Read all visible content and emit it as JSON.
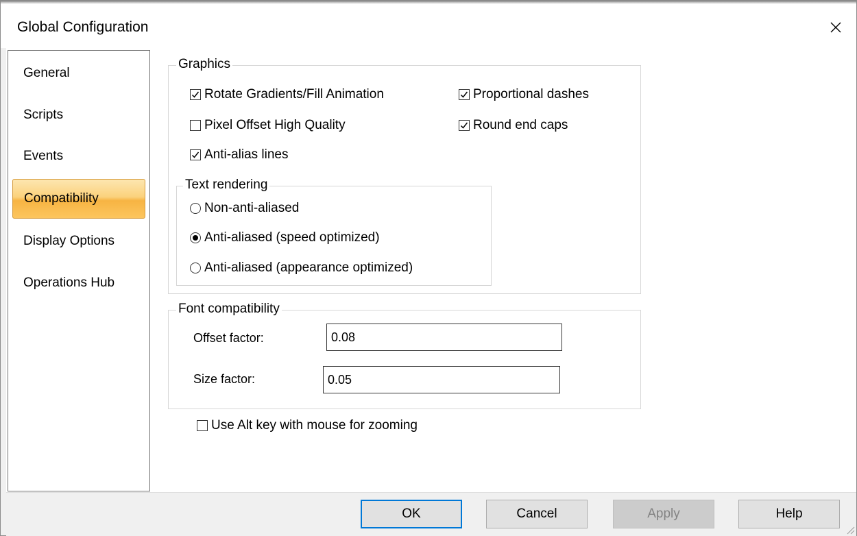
{
  "window": {
    "title": "Global Configuration",
    "close_icon": "close-icon"
  },
  "sidebar": {
    "items": [
      {
        "label": "General",
        "active": false
      },
      {
        "label": "Scripts",
        "active": false
      },
      {
        "label": "Events",
        "active": false
      },
      {
        "label": "Compatibility",
        "active": true
      },
      {
        "label": "Display Options",
        "active": false
      },
      {
        "label": "Operations Hub",
        "active": false
      }
    ]
  },
  "graphics": {
    "group_label": "Graphics",
    "options": {
      "rotate_gradients": {
        "label": "Rotate Gradients/Fill Animation",
        "checked": true
      },
      "pixel_offset": {
        "label": "Pixel Offset High Quality",
        "checked": false
      },
      "anti_alias_lines": {
        "label": "Anti-alias lines",
        "checked": true
      },
      "proportional_dashes": {
        "label": "Proportional dashes",
        "checked": true
      },
      "round_end_caps": {
        "label": "Round end caps",
        "checked": true
      }
    },
    "text_rendering": {
      "group_label": "Text rendering",
      "options": [
        {
          "label": "Non-anti-aliased",
          "selected": false
        },
        {
          "label": "Anti-aliased (speed optimized)",
          "selected": true
        },
        {
          "label": "Anti-aliased (appearance optimized)",
          "selected": false
        }
      ]
    }
  },
  "font_compatibility": {
    "group_label": "Font compatibility",
    "offset_factor": {
      "label": "Offset factor:",
      "value": "0.08"
    },
    "size_factor": {
      "label": "Size factor:",
      "value": "0.05"
    }
  },
  "alt_key_zoom": {
    "label": "Use Alt key with mouse for zooming",
    "checked": false
  },
  "buttons": {
    "ok": "OK",
    "cancel": "Cancel",
    "apply": "Apply",
    "help": "Help"
  },
  "colors": {
    "accent_default_button": "#0078d7",
    "selected_item_gradient_top": "#fde6b0",
    "selected_item_gradient_bottom": "#f7b443"
  }
}
